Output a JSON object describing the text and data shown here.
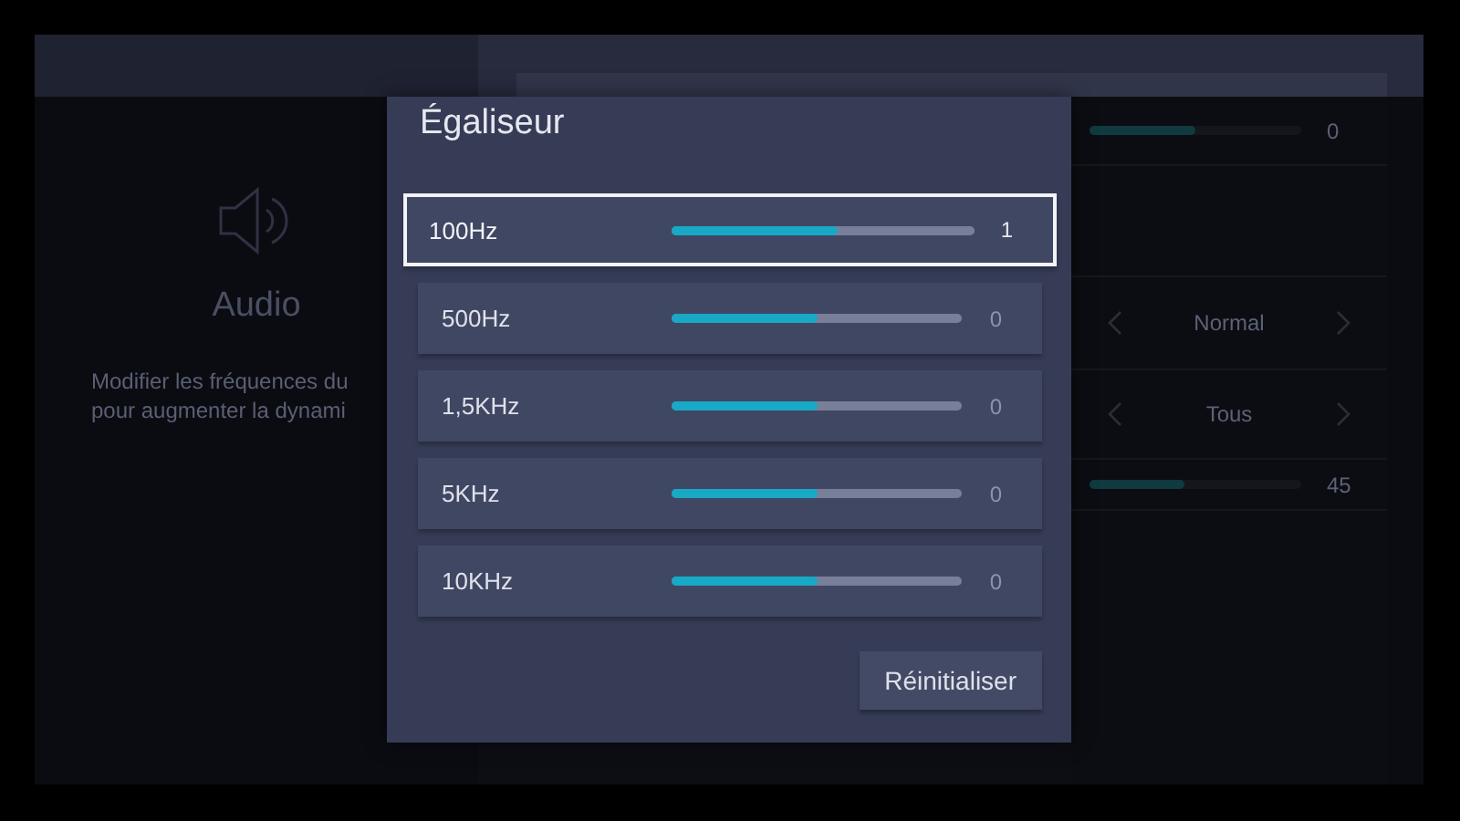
{
  "background": {
    "audio_panel": {
      "title": "Audio",
      "description_lines": [
        "Modifier les fréquences du",
        "pour augmenter la dynami"
      ]
    },
    "settings": [
      {
        "kind": "slider",
        "level": 0.5,
        "reading": "0"
      },
      {
        "kind": "blank"
      },
      {
        "kind": "choice",
        "value": "Normal"
      },
      {
        "kind": "choice",
        "value": "Tous"
      },
      {
        "kind": "slider",
        "level": 0.45,
        "reading": "45"
      }
    ]
  },
  "dialog": {
    "title": "Égaliseur",
    "bands": [
      {
        "label": "100Hz",
        "level": 0.55,
        "reading": "1",
        "selected": true
      },
      {
        "label": "500Hz",
        "level": 0.5,
        "reading": "0",
        "selected": false
      },
      {
        "label": "1,5KHz",
        "level": 0.5,
        "reading": "0",
        "selected": false
      },
      {
        "label": "5KHz",
        "level": 0.5,
        "reading": "0",
        "selected": false
      },
      {
        "label": "10KHz",
        "level": 0.5,
        "reading": "0",
        "selected": false
      }
    ],
    "reset_button": "Réinitialiser"
  }
}
